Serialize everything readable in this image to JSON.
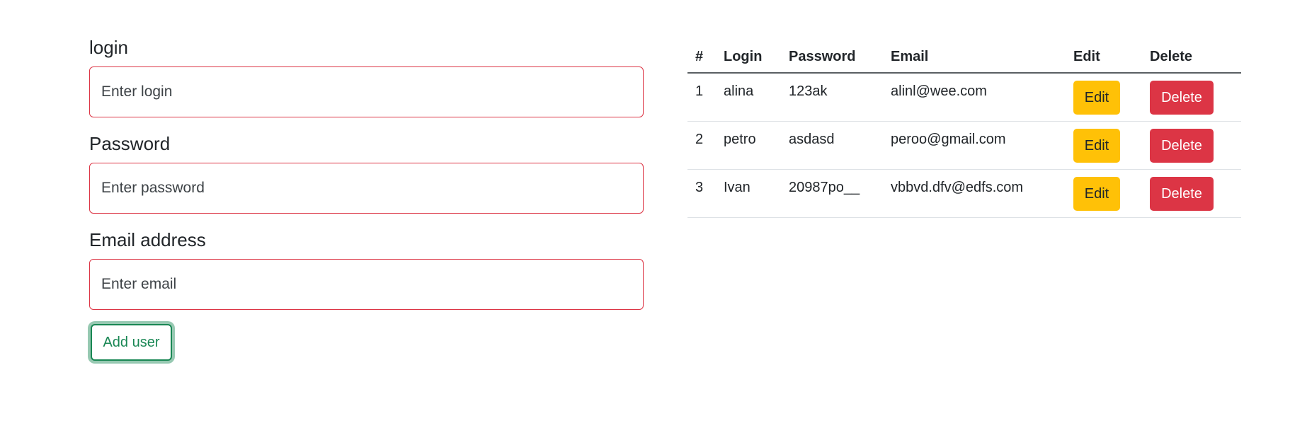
{
  "form": {
    "login_label": "login",
    "login_placeholder": "Enter login",
    "password_label": "Password",
    "password_placeholder": "Enter password",
    "email_label": "Email address",
    "email_placeholder": "Enter email",
    "add_button": "Add user"
  },
  "table": {
    "headers": [
      "#",
      "Login",
      "Password",
      "Email",
      "Edit",
      "Delete"
    ],
    "rows": [
      {
        "num": "1",
        "login": "alina",
        "password": "123ak",
        "email": "alinl@wee.com",
        "edit": "Edit",
        "delete": "Delete"
      },
      {
        "num": "2",
        "login": "petro",
        "password": "asdasd",
        "email": "peroo@gmail.com",
        "edit": "Edit",
        "delete": "Delete"
      },
      {
        "num": "3",
        "login": "Ivan",
        "password": "20987po__",
        "email": "vbbvd.dfv@edfs.com",
        "edit": "Edit",
        "delete": "Delete"
      }
    ]
  },
  "colors": {
    "invalid_border": "#dc3545",
    "success": "#198754",
    "warning": "#ffc107",
    "danger": "#dc3545"
  }
}
